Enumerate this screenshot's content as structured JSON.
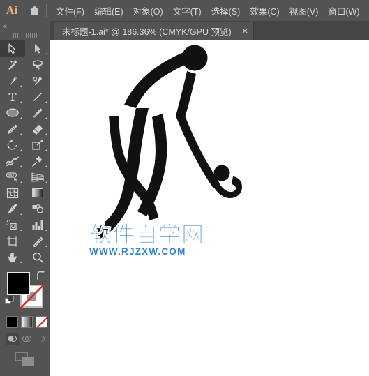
{
  "app": {
    "name": "Ai",
    "logo_color": "#e8a87c",
    "chrome_color": "#535353",
    "tabbar_color": "#454545"
  },
  "menubar": {
    "home_icon": "home-icon",
    "items": [
      {
        "label": "文件(F)"
      },
      {
        "label": "编辑(E)"
      },
      {
        "label": "对象(O)"
      },
      {
        "label": "文字(T)"
      },
      {
        "label": "选择(S)"
      },
      {
        "label": "效果(C)"
      },
      {
        "label": "视图(V)"
      },
      {
        "label": "窗口(W)"
      }
    ]
  },
  "tabbar": {
    "document": {
      "title": "未标题-1.ai* @ 186.36% (CMYK/GPU 预览)",
      "close_label": "✕",
      "zoom_level": "186.36%",
      "color_mode": "CMYK/GPU 预览",
      "modified": true
    }
  },
  "toolpanel": {
    "collapse_label": "«",
    "grip": "drag-grip",
    "active_tool": "selection-tool",
    "tools": [
      {
        "name": "selection-tool",
        "icon": "arrow-solid-icon",
        "active": true,
        "has_flyout": false
      },
      {
        "name": "direct-selection-tool",
        "icon": "arrow-direct-icon",
        "active": false,
        "has_flyout": true
      },
      {
        "name": "magic-wand-tool",
        "icon": "magic-wand-icon",
        "active": false,
        "has_flyout": false
      },
      {
        "name": "lasso-tool",
        "icon": "lasso-icon",
        "active": false,
        "has_flyout": false
      },
      {
        "name": "pen-tool",
        "icon": "pen-icon",
        "active": false,
        "has_flyout": true
      },
      {
        "name": "curvature-tool",
        "icon": "curvature-icon",
        "active": false,
        "has_flyout": false
      },
      {
        "name": "type-tool",
        "icon": "type-t-icon",
        "active": false,
        "has_flyout": true
      },
      {
        "name": "line-segment-tool",
        "icon": "line-segment-icon",
        "active": false,
        "has_flyout": true
      },
      {
        "name": "ellipse-tool",
        "icon": "ellipse-icon",
        "active": false,
        "has_flyout": true
      },
      {
        "name": "paintbrush-tool",
        "icon": "paintbrush-icon",
        "active": false,
        "has_flyout": true
      },
      {
        "name": "shaper-pencil-tool",
        "icon": "pencil-icon",
        "active": false,
        "has_flyout": true
      },
      {
        "name": "eraser-tool",
        "icon": "eraser-icon",
        "active": false,
        "has_flyout": true
      },
      {
        "name": "rotate-tool",
        "icon": "rotate-icon",
        "active": false,
        "has_flyout": true
      },
      {
        "name": "scale-tool",
        "icon": "scale-icon",
        "active": false,
        "has_flyout": true
      },
      {
        "name": "width-warp-tool",
        "icon": "warp-icon",
        "active": false,
        "has_flyout": true
      },
      {
        "name": "free-transform-tool",
        "icon": "pushpin-icon",
        "active": false,
        "has_flyout": true
      },
      {
        "name": "shape-builder-tool",
        "icon": "shape-builder-icon",
        "active": false,
        "has_flyout": true
      },
      {
        "name": "perspective-grid-tool",
        "icon": "perspective-grid-icon",
        "active": false,
        "has_flyout": true
      },
      {
        "name": "mesh-tool",
        "icon": "mesh-icon",
        "active": false,
        "has_flyout": false
      },
      {
        "name": "gradient-tool",
        "icon": "gradient-icon",
        "active": false,
        "has_flyout": false
      },
      {
        "name": "eyedropper-tool",
        "icon": "eyedropper-icon",
        "active": false,
        "has_flyout": true
      },
      {
        "name": "blend-tool",
        "icon": "blend-icon",
        "active": false,
        "has_flyout": false
      },
      {
        "name": "symbol-sprayer-tool",
        "icon": "symbol-sprayer-icon",
        "active": false,
        "has_flyout": true
      },
      {
        "name": "column-graph-tool",
        "icon": "bar-graph-icon",
        "active": false,
        "has_flyout": true
      },
      {
        "name": "artboard-tool",
        "icon": "artboard-icon",
        "active": false,
        "has_flyout": false
      },
      {
        "name": "slice-tool",
        "icon": "slice-knife-icon",
        "active": false,
        "has_flyout": true
      },
      {
        "name": "hand-tool",
        "icon": "hand-icon",
        "active": false,
        "has_flyout": true
      },
      {
        "name": "zoom-tool",
        "icon": "magnifier-icon",
        "active": false,
        "has_flyout": false
      }
    ],
    "color_controls": {
      "fill_name": "fill-swatch",
      "fill_color": "#000000",
      "stroke_name": "stroke-swatch",
      "stroke_color": "#ffffff",
      "stroke_is_none": true,
      "swap_icon": "swap-fill-stroke-icon",
      "default_icon": "default-fill-stroke-icon",
      "mode_buttons": [
        {
          "name": "color-mode-solid",
          "icon": "solid-color-icon",
          "selected": true
        },
        {
          "name": "color-mode-gradient",
          "icon": "gradient-icon",
          "selected": false
        },
        {
          "name": "color-mode-none",
          "icon": "none-slash-icon",
          "selected": false
        }
      ],
      "draw_buttons": [
        {
          "name": "draw-normal-mode",
          "icon": "draw-normal-icon",
          "selected": true
        },
        {
          "name": "draw-behind-mode",
          "icon": "draw-behind-icon",
          "selected": false
        },
        {
          "name": "draw-inside-mode",
          "icon": "draw-inside-icon",
          "selected": false
        }
      ],
      "screen_mode": {
        "name": "change-screen-mode",
        "icon": "screen-mode-icon"
      }
    }
  },
  "canvas": {
    "background": "#ffffff",
    "artwork": {
      "name": "field-hockey-player-pictogram",
      "fill_color": "#000000",
      "description": "黑色曲棍球运动员剪影"
    },
    "watermark": {
      "text_cn": "软件自学网",
      "text_url": "WWW.RJZXW.COM",
      "color": "#2a7fc4"
    }
  }
}
